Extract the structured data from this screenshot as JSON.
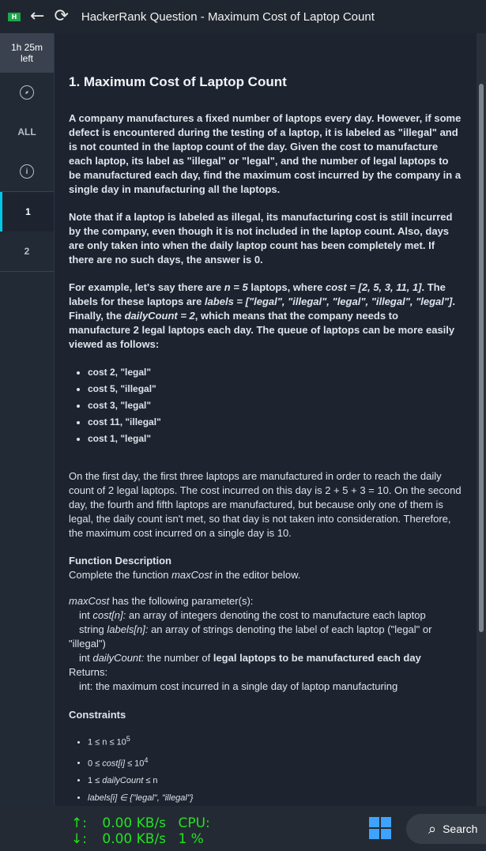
{
  "window": {
    "logo": "H",
    "back_icon": "←",
    "refresh_icon": "⟳",
    "title": "HackerRank Question - Maximum Cost of Laptop Count"
  },
  "sidebar": {
    "timer_line1": "1h 25m",
    "timer_line2": "left",
    "all_label": "ALL",
    "info_icon": "i",
    "question_1": "1",
    "question_2": "2"
  },
  "question": {
    "title": "1. Maximum Cost of Laptop Count",
    "para1": "A company manufactures a fixed number of laptops every day. However, if some defect is encountered during the testing of a laptop, it is labeled as \"illegal\" and is not counted in the laptop count of the day. Given the cost to manufacture each laptop, its label as \"illegal\" or \"legal\", and the number of legal laptops to be manufactured each day, find the maximum cost incurred by the company in a single day in manufacturing all the laptops.",
    "para2": "Note that if a laptop is labeled as illegal, its manufacturing cost is still incurred by the company, even though it is not included in the laptop count. Also, days are only taken into when the daily laptop count has been completely met. If there are no such days, the answer is 0.",
    "example": {
      "p1": "For example, let's say there are ",
      "n_eq": "n = 5",
      "p2": " laptops, where ",
      "cost_eq": "cost = [2, 5, 3, 11, 1]",
      "p3": ". The labels for these laptops are ",
      "labels_eq": "labels = [\"legal\", \"illegal\", \"legal\", \"illegal\", \"legal\"]",
      "p4": ". Finally, the ",
      "daily_eq": "dailyCount = 2",
      "p5": ", which means that the company needs to manufacture 2 legal laptops each day. The queue of laptops can be more easily viewed as follows:"
    },
    "cases": [
      "cost 2, \"legal\"",
      "cost 5, \"illegal\"",
      "cost 3, \"legal\"",
      "cost 11, \"illegal\"",
      "cost 1, \"legal\""
    ],
    "explanation": "On the first day, the first three laptops are manufactured in order to reach the daily count of 2 legal laptops. The cost incurred on this day is 2 + 5 + 3 = 10. On the second day, the fourth and fifth laptops are manufactured, but because only one of them is legal, the daily count isn't met, so that day is not taken into consideration. Therefore, the maximum cost incurred on a single day is 10.",
    "function_description": {
      "heading": "Function Description",
      "line_prefix": "Complete the function ",
      "fn_name": "maxCost",
      "line_suffix": " in the editor below."
    },
    "params": {
      "fn_name": "maxCost",
      "header_suffix": " has the following parameter(s):",
      "cost_type": "int ",
      "cost_name": "cost[n]:",
      "cost_desc": "  an array of integers denoting the cost to manufacture each laptop",
      "labels_type": "string ",
      "labels_name": "labels[n]:",
      "labels_desc": " an array of strings denoting the label of each laptop (\"legal\" or \"illegal\")",
      "daily_type": "int ",
      "daily_name": "dailyCount:",
      "daily_desc_plain": " the number of ",
      "daily_desc_bold": "legal laptops to be manufactured each day",
      "returns_label": "Returns:",
      "returns_desc": "int: the maximum cost incurred in a single day of laptop manufacturing"
    },
    "constraints": {
      "heading": "Constraints",
      "c1": "1 ≤ n ≤ 10",
      "c1_sup": "5",
      "c2_pre": "0 ≤ ",
      "c2_var": "cost[i]",
      "c2_post": " ≤ 10",
      "c2_sup": "4",
      "c3_pre": "1 ≤ ",
      "c3_var": "dailyCount",
      "c3_post": " ≤ n",
      "c4": "labels[i] ∈ {\"legal\", \"illegal\"}"
    }
  },
  "taskbar": {
    "up_arrow": "↑:",
    "up_speed": "0.00 KB/s",
    "cpu_label": "CPU:",
    "down_arrow": "↓:",
    "down_speed": "0.00 KB/s",
    "cpu_value": "1 %",
    "search_icon": "⌕",
    "search_label": "Search"
  },
  "colors": {
    "accent": "#00c8e6",
    "net_text": "#22e222",
    "windows_blue": "#3ea3ff",
    "hackerrank_green": "#1ba94c"
  }
}
